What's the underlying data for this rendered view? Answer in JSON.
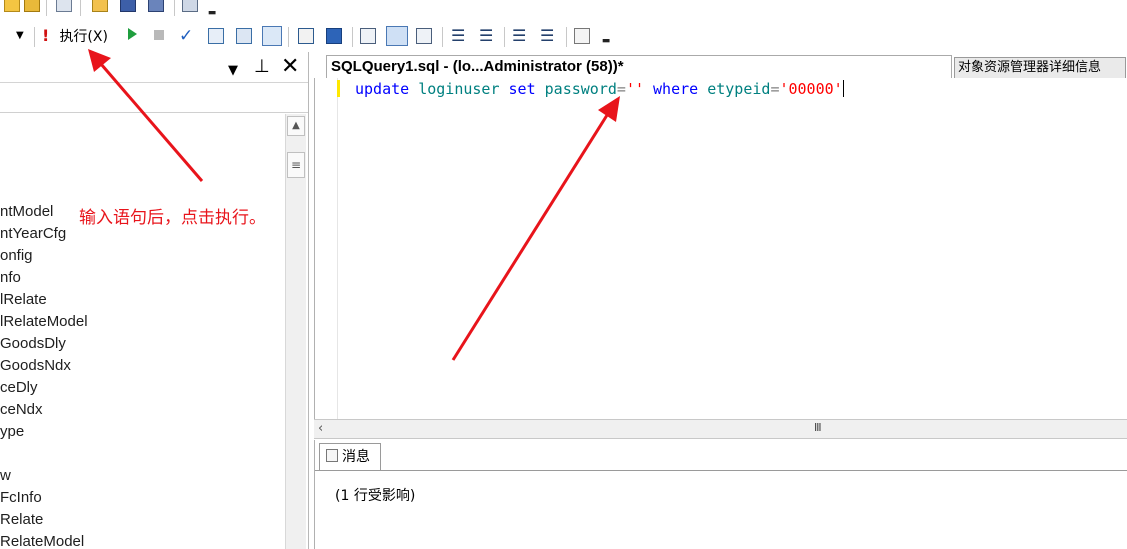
{
  "toolbar": {
    "execute_label": "执行(X)",
    "colors": {
      "execute_icon": "#d01010",
      "debug_icon": "#1f9e3e",
      "check_icon": "#1f5fbf"
    }
  },
  "explorer": {
    "tree_items": [
      "ntModel",
      "ntYearCfg",
      "onfig",
      "nfo",
      "lRelate",
      "lRelateModel",
      "GoodsDly",
      "GoodsNdx",
      "ceDly",
      "ceNdx",
      "ype",
      "",
      "w",
      "FcInfo",
      "Relate",
      "RelateModel"
    ]
  },
  "editor": {
    "active_tab": "SQLQuery1.sql - (lo...Administrator (58))*",
    "inactive_tab": "对象资源管理器详细信息",
    "sql": {
      "kw1": "update",
      "id1": "loginuser",
      "kw2": "set",
      "id2": "password",
      "op1": "=",
      "str1": "''",
      "kw3": "where",
      "id3": "etypeid",
      "op2": "=",
      "str2": "'00000'"
    }
  },
  "results": {
    "tab_label": "消息",
    "message": "(1 行受影响)"
  },
  "annotation": {
    "note": "输入语句后，点击执行。",
    "color": "#e8141b"
  }
}
